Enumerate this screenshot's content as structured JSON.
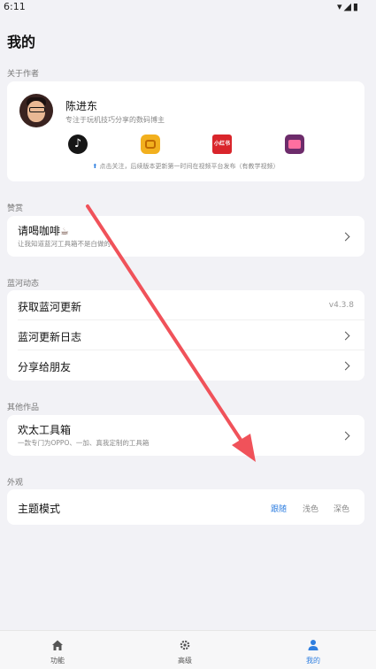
{
  "status_bar": {
    "time": "6:11",
    "icons": "▾◢▮"
  },
  "page": {
    "title": "我的"
  },
  "author_section": {
    "label": "关于作者",
    "name": "陈进东",
    "desc": "专注于玩机技巧分享的数码博主",
    "platforms": [
      {
        "icon": "tiktok-icon",
        "glyph": "♪"
      },
      {
        "icon": "bilibili-icon",
        "glyph": ""
      },
      {
        "icon": "xiaohongshu-icon",
        "glyph": "小红书"
      },
      {
        "icon": "tv-icon",
        "glyph": ""
      }
    ],
    "follow_note": "点击关注，后续版本更新第一时间在视频平台发布（有教学视频）",
    "follow_arrow": "⬆"
  },
  "donate_section": {
    "label": "赞赏",
    "title": "请喝咖啡",
    "subtitle": "让我知道蓝河工具箱不是白做的"
  },
  "bluecove_section": {
    "label": "蓝河动态",
    "rows": [
      {
        "title": "获取蓝河更新",
        "value": "v4.3.8"
      },
      {
        "title": "蓝河更新日志"
      },
      {
        "title": "分享给朋友"
      }
    ]
  },
  "other_section": {
    "label": "其他作品",
    "title": "欢太工具箱",
    "subtitle": "一款专门为OPPO、一加、真我定制的工具箱"
  },
  "appearance_section": {
    "label": "外观",
    "title": "主题模式",
    "options": [
      "跟随",
      "浅色",
      "深色"
    ],
    "selected": "跟随"
  },
  "bottom_nav": [
    {
      "label": "功能",
      "icon": "home-icon"
    },
    {
      "label": "高级",
      "icon": "gear-icon"
    },
    {
      "label": "我的",
      "icon": "person-icon",
      "active": true
    }
  ],
  "colors": {
    "accent": "#2f7fe0",
    "arrow": "#f0525a",
    "background": "#f2f2f6"
  }
}
